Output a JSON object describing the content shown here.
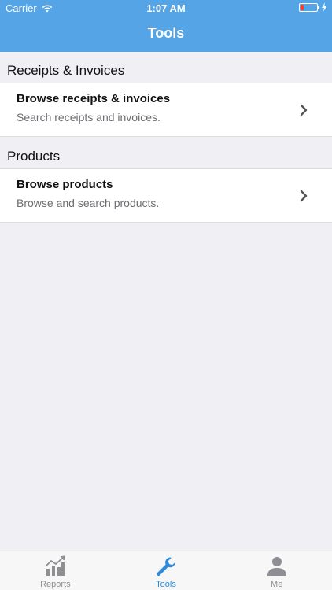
{
  "status_bar": {
    "carrier": "Carrier",
    "time": "1:07 AM"
  },
  "nav": {
    "title": "Tools"
  },
  "sections": [
    {
      "header": "Receipts & Invoices",
      "cell": {
        "title": "Browse receipts & invoices",
        "subtitle": "Search receipts and invoices."
      }
    },
    {
      "header": "Products",
      "cell": {
        "title": "Browse products",
        "subtitle": "Browse and search products."
      }
    }
  ],
  "tab_bar": {
    "tabs": [
      {
        "label": "Reports",
        "icon": "chart-icon",
        "active": false
      },
      {
        "label": "Tools",
        "icon": "wrench-icon",
        "active": true
      },
      {
        "label": "Me",
        "icon": "person-icon",
        "active": false
      }
    ]
  },
  "colors": {
    "header_bg": "#55a4e6",
    "tab_active": "#2f8ad9",
    "tab_inactive": "#8e8e93",
    "background": "#efeff4"
  }
}
